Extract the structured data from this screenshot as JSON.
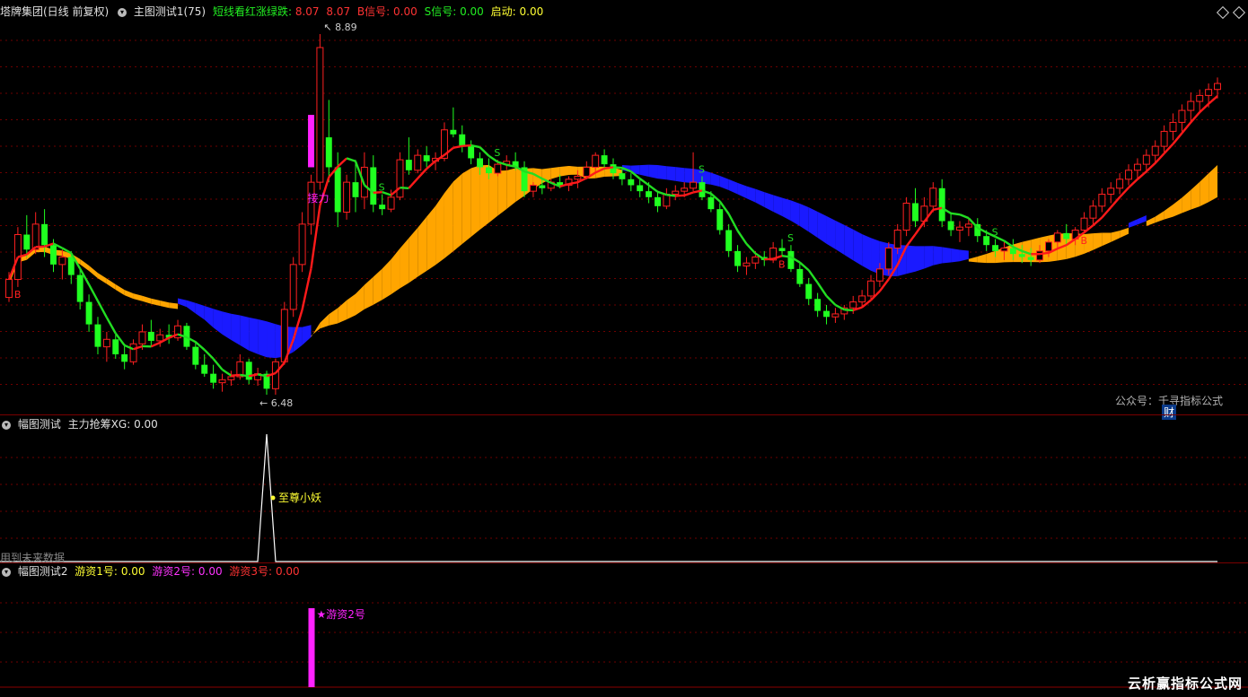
{
  "main_header": {
    "stock": "塔牌集团(日线 前复权)",
    "indicator": "主图测试1(75)",
    "legend_label": "短线看红涨绿跌:",
    "legend_val1": "8.07",
    "legend_val2": "8.07",
    "b_label": "B信号:",
    "b_val": "0.00",
    "s_label": "S信号:",
    "s_val": "0.00",
    "start_label": "启动:",
    "start_val": "0.00"
  },
  "sub1_header": {
    "name": "幅图测试",
    "label": "主力抢筹XG:",
    "val": "0.00"
  },
  "sub2_header": {
    "name": "幅图测试2",
    "l1": "游资1号:",
    "v1": "0.00",
    "l2": "游资2号:",
    "v2": "0.00",
    "l3": "游资3号:",
    "v3": "0.00"
  },
  "watermark": "公众号：千寻指标公式",
  "badge": "财",
  "future_note": "用到未来数据",
  "corner_brand": "云析赢指标公式网",
  "colors": {
    "up": "#ff2020",
    "down": "#20ff20",
    "ma_red": "#ff1a1a",
    "ma_green": "#22dd22",
    "band_blue": "#1a1aff",
    "band_orange": "#ffa500",
    "magenta": "#ff22ff",
    "grid": "#6e0000"
  },
  "chart_data": [
    {
      "type": "candlestick",
      "title": "塔牌集团(日线 前复权)",
      "high_label": "8.89",
      "low_label": "6.48",
      "high": 8.89,
      "low": 6.48,
      "annotations": [
        {
          "text": "接力",
          "index": 34
        },
        {
          "text": "S",
          "index": 42
        },
        {
          "text": "S",
          "index": 55
        },
        {
          "text": "S",
          "index": 78
        },
        {
          "text": "S",
          "index": 88
        },
        {
          "text": "S",
          "index": 111
        },
        {
          "text": "B",
          "index": 1
        },
        {
          "text": "B",
          "index": 87
        },
        {
          "text": "B",
          "index": 121
        }
      ],
      "ohlc": [
        [
          7.13,
          7.3,
          7.1,
          7.25
        ],
        [
          7.25,
          7.6,
          7.2,
          7.55
        ],
        [
          7.55,
          7.68,
          7.4,
          7.45
        ],
        [
          7.45,
          7.7,
          7.42,
          7.62
        ],
        [
          7.62,
          7.72,
          7.4,
          7.48
        ],
        [
          7.48,
          7.52,
          7.3,
          7.35
        ],
        [
          7.35,
          7.45,
          7.25,
          7.4
        ],
        [
          7.4,
          7.44,
          7.22,
          7.28
        ],
        [
          7.28,
          7.32,
          7.05,
          7.1
        ],
        [
          7.1,
          7.15,
          6.9,
          6.95
        ],
        [
          6.95,
          7.0,
          6.75,
          6.8
        ],
        [
          6.8,
          6.9,
          6.7,
          6.85
        ],
        [
          6.85,
          6.88,
          6.72,
          6.75
        ],
        [
          6.75,
          6.82,
          6.65,
          6.7
        ],
        [
          6.7,
          6.85,
          6.68,
          6.82
        ],
        [
          6.82,
          6.95,
          6.78,
          6.9
        ],
        [
          6.9,
          6.98,
          6.8,
          6.84
        ],
        [
          6.84,
          6.92,
          6.8,
          6.88
        ],
        [
          6.88,
          6.95,
          6.82,
          6.86
        ],
        [
          6.86,
          6.98,
          6.84,
          6.94
        ],
        [
          6.94,
          6.96,
          6.78,
          6.8
        ],
        [
          6.8,
          6.84,
          6.65,
          6.68
        ],
        [
          6.68,
          6.75,
          6.6,
          6.62
        ],
        [
          6.62,
          6.68,
          6.52,
          6.56
        ],
        [
          6.56,
          6.62,
          6.5,
          6.58
        ],
        [
          6.58,
          6.64,
          6.54,
          6.6
        ],
        [
          6.6,
          6.75,
          6.58,
          6.7
        ],
        [
          6.7,
          6.72,
          6.55,
          6.58
        ],
        [
          6.58,
          6.66,
          6.54,
          6.62
        ],
        [
          6.62,
          6.64,
          6.48,
          6.52
        ],
        [
          6.52,
          6.72,
          6.48,
          6.7
        ],
        [
          6.7,
          7.1,
          6.68,
          7.05
        ],
        [
          7.05,
          7.4,
          7.0,
          7.35
        ],
        [
          7.35,
          7.7,
          7.3,
          7.62
        ],
        [
          7.62,
          7.95,
          7.55,
          7.9
        ],
        [
          7.9,
          8.89,
          7.85,
          8.8
        ],
        [
          8.2,
          8.45,
          7.9,
          8.0
        ],
        [
          8.0,
          8.1,
          7.6,
          7.7
        ],
        [
          7.7,
          7.95,
          7.65,
          7.9
        ],
        [
          7.9,
          8.05,
          7.7,
          7.8
        ],
        [
          7.8,
          8.1,
          7.72,
          8.0
        ],
        [
          8.0,
          8.08,
          7.7,
          7.75
        ],
        [
          7.75,
          7.82,
          7.68,
          7.72
        ],
        [
          7.72,
          7.85,
          7.7,
          7.8
        ],
        [
          7.8,
          8.1,
          7.78,
          8.05
        ],
        [
          8.05,
          8.2,
          7.95,
          7.98
        ],
        [
          7.98,
          8.12,
          7.96,
          8.08
        ],
        [
          8.08,
          8.14,
          8.0,
          8.04
        ],
        [
          8.04,
          8.1,
          7.98,
          8.06
        ],
        [
          8.06,
          8.3,
          8.04,
          8.25
        ],
        [
          8.25,
          8.4,
          8.2,
          8.22
        ],
        [
          8.22,
          8.28,
          8.1,
          8.14
        ],
        [
          8.14,
          8.18,
          8.02,
          8.06
        ],
        [
          8.06,
          8.1,
          7.95,
          8.0
        ],
        [
          8.0,
          8.06,
          7.92,
          7.96
        ],
        [
          7.96,
          8.05,
          7.94,
          8.02
        ],
        [
          8.02,
          8.08,
          7.98,
          8.04
        ],
        [
          8.04,
          8.1,
          7.98,
          8.0
        ],
        [
          8.0,
          8.04,
          7.8,
          7.84
        ],
        [
          7.84,
          7.9,
          7.8,
          7.88
        ],
        [
          7.88,
          7.92,
          7.82,
          7.86
        ],
        [
          7.86,
          7.92,
          7.84,
          7.9
        ],
        [
          7.9,
          7.95,
          7.86,
          7.88
        ],
        [
          7.88,
          7.94,
          7.84,
          7.92
        ],
        [
          7.92,
          7.98,
          7.86,
          7.94
        ],
        [
          7.94,
          8.04,
          7.92,
          8.0
        ],
        [
          8.0,
          8.1,
          7.96,
          8.08
        ],
        [
          8.08,
          8.12,
          7.98,
          8.02
        ],
        [
          8.02,
          8.06,
          7.92,
          7.96
        ],
        [
          7.96,
          8.0,
          7.88,
          7.92
        ],
        [
          7.92,
          7.96,
          7.84,
          7.88
        ],
        [
          7.88,
          7.92,
          7.8,
          7.84
        ],
        [
          7.84,
          7.9,
          7.76,
          7.8
        ],
        [
          7.8,
          7.84,
          7.7,
          7.74
        ],
        [
          7.74,
          7.86,
          7.72,
          7.82
        ],
        [
          7.82,
          7.88,
          7.78,
          7.84
        ],
        [
          7.84,
          7.9,
          7.8,
          7.86
        ],
        [
          7.86,
          8.1,
          7.84,
          7.9
        ],
        [
          7.9,
          7.94,
          7.78,
          7.8
        ],
        [
          7.8,
          7.84,
          7.7,
          7.72
        ],
        [
          7.72,
          7.76,
          7.55,
          7.58
        ],
        [
          7.58,
          7.62,
          7.4,
          7.44
        ],
        [
          7.44,
          7.48,
          7.3,
          7.34
        ],
        [
          7.34,
          7.4,
          7.28,
          7.36
        ],
        [
          7.36,
          7.44,
          7.32,
          7.4
        ],
        [
          7.4,
          7.44,
          7.34,
          7.38
        ],
        [
          7.38,
          7.5,
          7.36,
          7.46
        ],
        [
          7.46,
          7.52,
          7.4,
          7.44
        ],
        [
          7.44,
          7.48,
          7.3,
          7.32
        ],
        [
          7.32,
          7.36,
          7.2,
          7.22
        ],
        [
          7.22,
          7.26,
          7.08,
          7.12
        ],
        [
          7.12,
          7.16,
          7.0,
          7.04
        ],
        [
          7.04,
          7.08,
          6.95,
          7.0
        ],
        [
          7.0,
          7.06,
          6.96,
          7.02
        ],
        [
          7.02,
          7.08,
          6.98,
          7.06
        ],
        [
          7.06,
          7.14,
          7.02,
          7.1
        ],
        [
          7.1,
          7.18,
          7.06,
          7.14
        ],
        [
          7.14,
          7.28,
          7.12,
          7.24
        ],
        [
          7.24,
          7.36,
          7.2,
          7.32
        ],
        [
          7.32,
          7.5,
          7.28,
          7.46
        ],
        [
          7.46,
          7.62,
          7.42,
          7.58
        ],
        [
          7.58,
          7.8,
          7.54,
          7.76
        ],
        [
          7.76,
          7.86,
          7.6,
          7.64
        ],
        [
          7.64,
          7.8,
          7.6,
          7.74
        ],
        [
          7.74,
          7.9,
          7.7,
          7.86
        ],
        [
          7.86,
          7.92,
          7.6,
          7.64
        ],
        [
          7.64,
          7.7,
          7.54,
          7.58
        ],
        [
          7.58,
          7.64,
          7.5,
          7.6
        ],
        [
          7.6,
          7.66,
          7.54,
          7.62
        ],
        [
          7.62,
          7.66,
          7.5,
          7.54
        ],
        [
          7.54,
          7.58,
          7.44,
          7.48
        ],
        [
          7.48,
          7.52,
          7.4,
          7.44
        ],
        [
          7.44,
          7.5,
          7.38,
          7.46
        ],
        [
          7.46,
          7.52,
          7.38,
          7.42
        ],
        [
          7.42,
          7.48,
          7.36,
          7.4
        ],
        [
          7.4,
          7.46,
          7.34,
          7.38
        ],
        [
          7.38,
          7.48,
          7.36,
          7.44
        ],
        [
          7.44,
          7.52,
          7.4,
          7.5
        ],
        [
          7.5,
          7.58,
          7.46,
          7.56
        ],
        [
          7.56,
          7.62,
          7.48,
          7.52
        ],
        [
          7.52,
          7.6,
          7.48,
          7.58
        ],
        [
          7.58,
          7.7,
          7.56,
          7.66
        ],
        [
          7.66,
          7.78,
          7.62,
          7.74
        ],
        [
          7.74,
          7.86,
          7.7,
          7.82
        ],
        [
          7.82,
          7.9,
          7.76,
          7.86
        ],
        [
          7.86,
          7.96,
          7.82,
          7.92
        ],
        [
          7.92,
          8.02,
          7.88,
          7.98
        ],
        [
          7.98,
          8.06,
          7.92,
          8.02
        ],
        [
          8.02,
          8.12,
          7.96,
          8.08
        ],
        [
          8.08,
          8.18,
          8.02,
          8.14
        ],
        [
          8.14,
          8.28,
          8.1,
          8.24
        ],
        [
          8.24,
          8.36,
          8.18,
          8.3
        ],
        [
          8.3,
          8.42,
          8.24,
          8.38
        ],
        [
          8.38,
          8.5,
          8.3,
          8.44
        ],
        [
          8.44,
          8.52,
          8.36,
          8.48
        ],
        [
          8.48,
          8.56,
          8.4,
          8.52
        ],
        [
          8.52,
          8.6,
          8.46,
          8.56
        ]
      ]
    },
    {
      "type": "line",
      "title": "主力抢筹XG",
      "spike_index": 29,
      "label": "至尊小妖"
    },
    {
      "type": "bar",
      "title": "游资2号",
      "bar_index": 34,
      "label": "★游资2号"
    }
  ]
}
